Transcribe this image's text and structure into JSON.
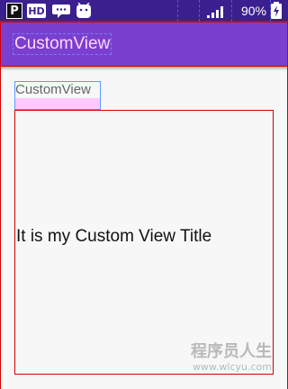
{
  "status_bar": {
    "left_icons": [
      "p-icon",
      "hd-icon",
      "chat-bubble-icon",
      "android-icon"
    ],
    "p_label": "P",
    "hd_label": "HD",
    "signal_icon": "signal-strength-icon",
    "battery_percent": "90%",
    "battery_icon": "battery-charging-icon"
  },
  "app_bar": {
    "title": "CustomView"
  },
  "content": {
    "label": "CustomView",
    "custom_view_title": "It is my Custom View Title"
  },
  "watermark": {
    "main": "程序员人生",
    "url": "www.wlcyu.com"
  },
  "colors": {
    "status_bar": "#3b1f8f",
    "app_bar": "#7a3fcf",
    "title_text": "#ffd7ff",
    "debug_red": "#d40000",
    "debug_blue": "#5a9cff",
    "pink_fill": "#ffc8ff",
    "background": "#f7f7f7"
  }
}
